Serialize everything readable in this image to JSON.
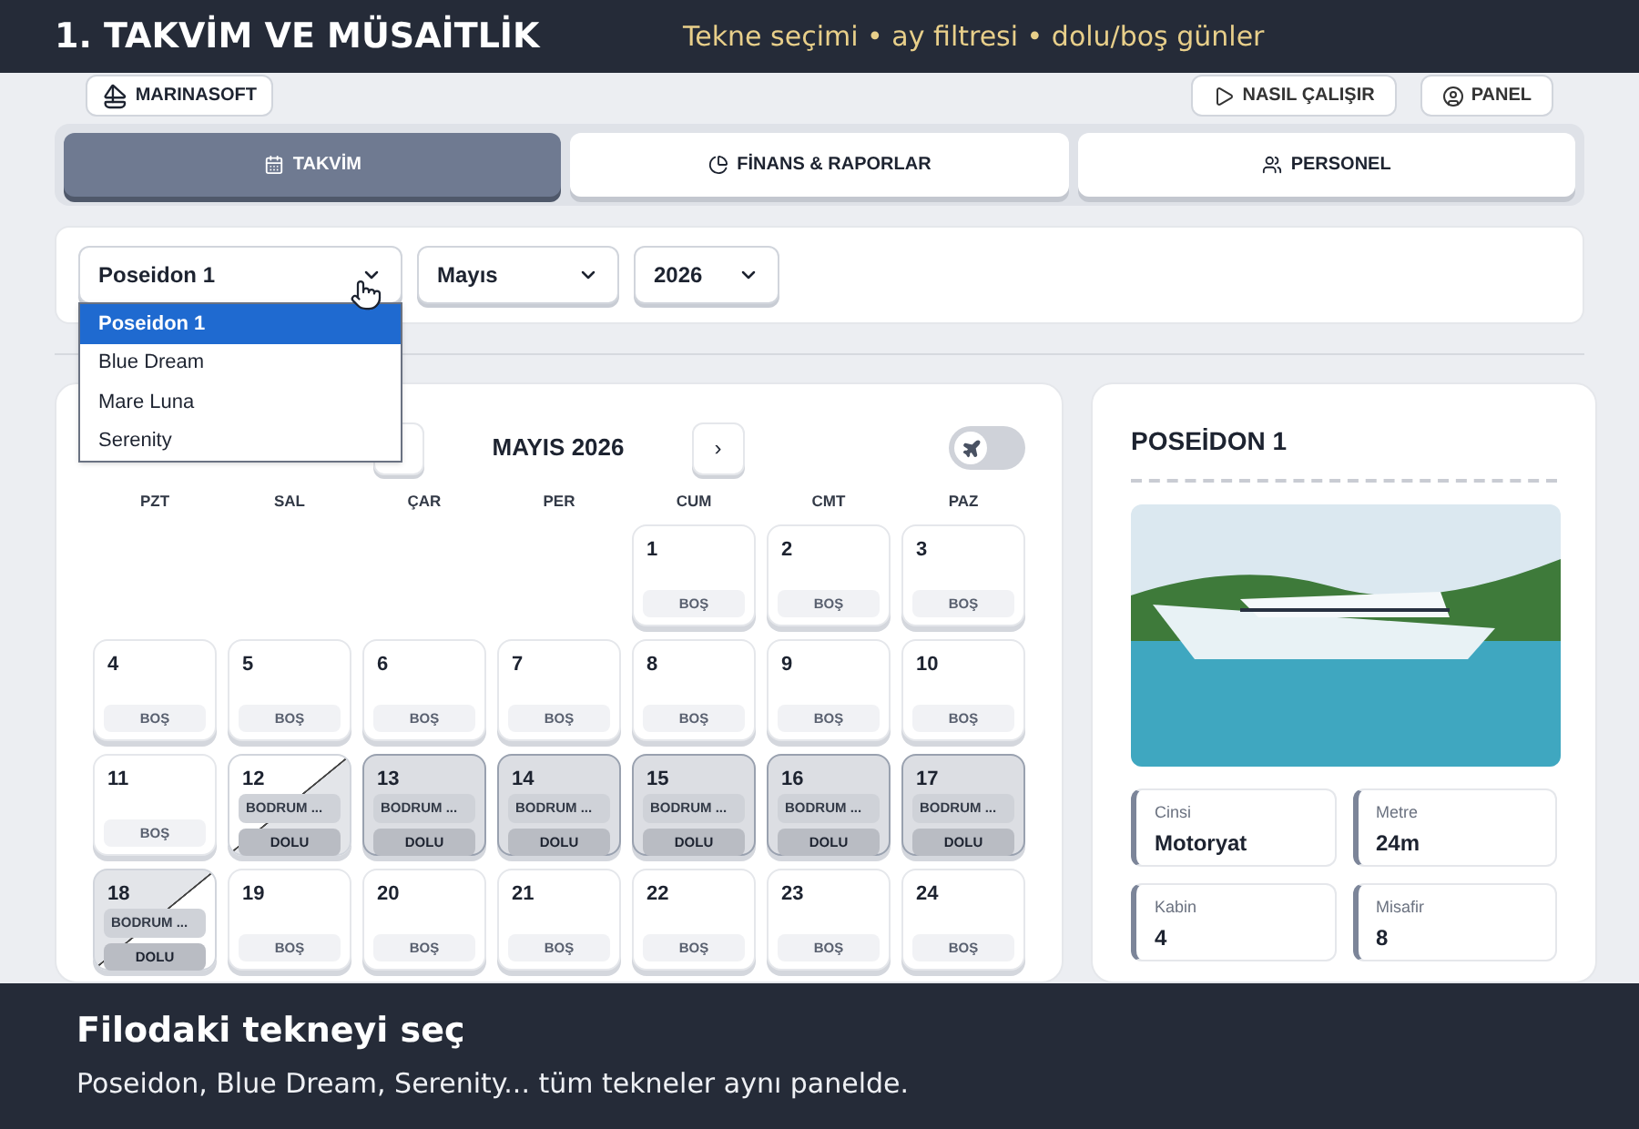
{
  "tutorial": {
    "step_title": "1. TAKVİM VE MÜSAİTLİK",
    "step_hint": "Tekne seçimi • ay filtresi • dolu/boş günler",
    "caption_title": "Filodaki tekneyi seç",
    "caption_text": "Poseidon, Blue Dream, Serenity... tüm tekneler aynı panelde."
  },
  "header": {
    "logo": "MARINASOFT",
    "buttons": [
      {
        "label": "NASIL ÇALIŞIR"
      },
      {
        "label": "PANEL"
      }
    ]
  },
  "tabs": [
    {
      "label": "TAKVİM",
      "selected": true
    },
    {
      "label": "FİNANS & RAPORLAR",
      "selected": false
    },
    {
      "label": "PERSONEL",
      "selected": false
    }
  ],
  "filters": {
    "boat": {
      "value": "Poseidon 1",
      "expanded": true,
      "options": [
        {
          "label": "Poseidon 1",
          "selected": true
        },
        {
          "label": "Blue Dream",
          "selected": false
        },
        {
          "label": "Mare Luna",
          "selected": false
        },
        {
          "label": "Serenity",
          "selected": false
        }
      ]
    },
    "month": {
      "value": "Mayıs"
    },
    "year": {
      "value": "2026"
    }
  },
  "calendar": {
    "title": "MAYIS 2026",
    "next": "›",
    "toggle_on": false,
    "weekdays": [
      "PZT",
      "SAL",
      "ÇAR",
      "PER",
      "CUM",
      "CMT",
      "PAZ"
    ],
    "weeks": [
      [
        {
          "day": "1",
          "kind": "free",
          "status": "BOŞ"
        },
        {
          "day": "2",
          "kind": "free",
          "status": "BOŞ"
        },
        {
          "day": "3",
          "kind": "free",
          "status": "BOŞ"
        }
      ],
      [
        {
          "day": "4",
          "kind": "free",
          "status": "BOŞ"
        },
        {
          "day": "5",
          "kind": "free",
          "status": "BOŞ"
        },
        {
          "day": "6",
          "kind": "free",
          "status": "BOŞ"
        },
        {
          "day": "7",
          "kind": "free",
          "status": "BOŞ"
        },
        {
          "day": "8",
          "kind": "free",
          "status": "BOŞ"
        },
        {
          "day": "9",
          "kind": "free",
          "status": "BOŞ"
        },
        {
          "day": "10",
          "kind": "free",
          "status": "BOŞ"
        }
      ],
      [
        {
          "day": "11",
          "kind": "free",
          "status": "BOŞ"
        },
        {
          "day": "12",
          "kind": "start",
          "place": "BODRUM ...",
          "status": "DOLU"
        },
        {
          "day": "13",
          "kind": "booked",
          "place": "BODRUM ...",
          "status": "DOLU"
        },
        {
          "day": "14",
          "kind": "booked",
          "place": "BODRUM ...",
          "status": "DOLU"
        },
        {
          "day": "15",
          "kind": "booked",
          "place": "BODRUM ...",
          "status": "DOLU"
        },
        {
          "day": "16",
          "kind": "booked",
          "place": "BODRUM ...",
          "status": "DOLU"
        },
        {
          "day": "17",
          "kind": "booked",
          "place": "BODRUM ...",
          "status": "DOLU"
        }
      ],
      [
        {
          "day": "18",
          "kind": "end",
          "place": "BODRUM ...",
          "status": "DOLU"
        },
        {
          "day": "19",
          "kind": "free",
          "status": "BOŞ"
        },
        {
          "day": "20",
          "kind": "free",
          "status": "BOŞ"
        },
        {
          "day": "21",
          "kind": "free",
          "status": "BOŞ"
        },
        {
          "day": "22",
          "kind": "free",
          "status": "BOŞ"
        },
        {
          "day": "23",
          "kind": "free",
          "status": "BOŞ"
        },
        {
          "day": "24",
          "kind": "free",
          "status": "BOŞ"
        }
      ]
    ]
  },
  "boat_panel": {
    "title": "POSEİDON 1",
    "specs": [
      {
        "label": "Cinsi",
        "value": "Motoryat"
      },
      {
        "label": "Metre",
        "value": "24m"
      },
      {
        "label": "Kabin",
        "value": "4"
      },
      {
        "label": "Misafir",
        "value": "8"
      }
    ]
  }
}
